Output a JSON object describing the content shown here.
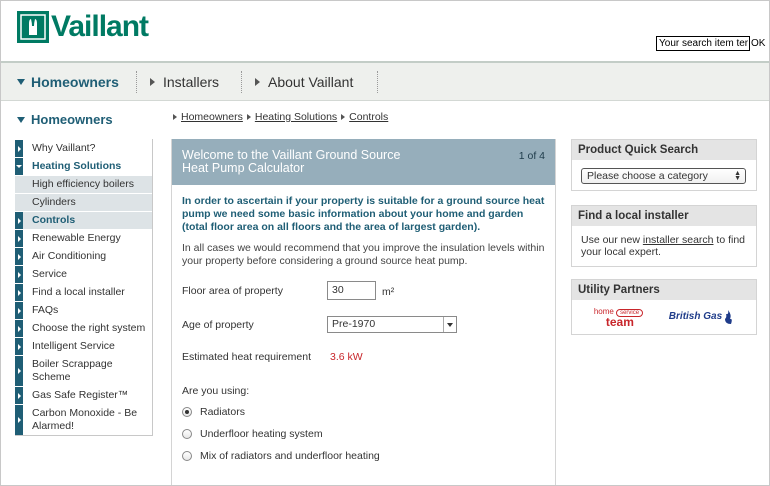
{
  "header": {
    "logo_text": "Vaillant",
    "search_value": "Your search item ter",
    "search_ok": "OK"
  },
  "nav": {
    "items": [
      "Homeowners",
      "Installers",
      "About Vaillant"
    ]
  },
  "sidebar": {
    "title": "Homeowners",
    "items": [
      {
        "label": "Why Vaillant?"
      },
      {
        "label": "Heating Solutions"
      },
      {
        "label": "High efficiency boilers"
      },
      {
        "label": "Cylinders"
      },
      {
        "label": "Controls"
      },
      {
        "label": "Renewable Energy"
      },
      {
        "label": "Air Conditioning"
      },
      {
        "label": "Service"
      },
      {
        "label": "Find a local installer"
      },
      {
        "label": "FAQs"
      },
      {
        "label": "Choose the right system"
      },
      {
        "label": "Intelligent Service"
      },
      {
        "label": "Boiler Scrappage Scheme"
      },
      {
        "label": "Gas Safe Register™"
      },
      {
        "label": "Carbon Monoxide - Be Alarmed!"
      }
    ]
  },
  "breadcrumb": [
    "Homeowners",
    "Heating Solutions",
    "Controls"
  ],
  "calculator": {
    "title": "Welcome to the Vaillant Ground Source Heat Pump Calculator",
    "step": "1 of 4",
    "intro_bold": "In order to ascertain if your property is suitable for a ground source heat pump we need some basic information about your home and garden (total floor area on all floors and the area of largest garden).",
    "intro_text": "In all cases we would recommend that you improve the insulation levels within your property before considering a ground source heat pump.",
    "floor_label": "Floor area of property",
    "floor_value": "30",
    "floor_unit": "m²",
    "age_label": "Age of property",
    "age_value": "Pre-1970",
    "heat_label": "Estimated heat requirement",
    "heat_value": "3.6 kW",
    "using_label": "Are you using:",
    "options": [
      "Radiators",
      "Underfloor heating system",
      "Mix of radiators and underfloor heating"
    ]
  },
  "right": {
    "quick_search_title": "Product Quick Search",
    "quick_search_select": "Please choose a category",
    "installer_title": "Find a local installer",
    "installer_text_pre": "Use our new ",
    "installer_link": "installer search",
    "installer_text_post": " to find your local expert.",
    "partners_title": "Utility Partners",
    "partner_home_small": "home",
    "partner_home_tag": "service",
    "partner_home_big": "team",
    "partner_bgas": "British Gas"
  }
}
